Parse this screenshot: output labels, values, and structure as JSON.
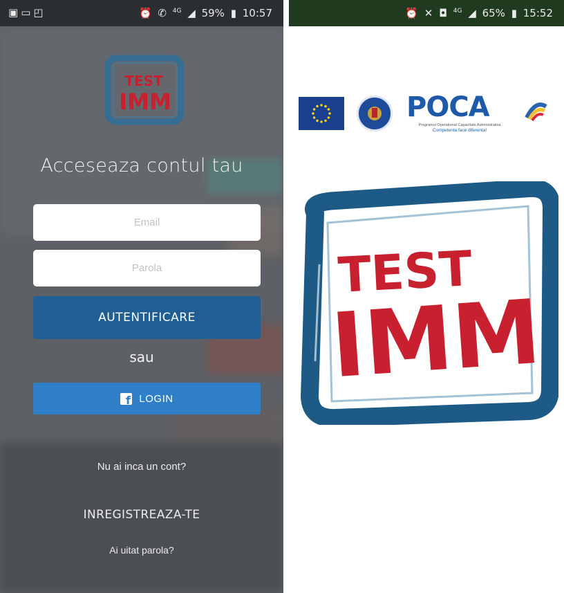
{
  "left_screen": {
    "status_bar": {
      "left_icons": [
        "image-icon",
        "laptop-icon",
        "file-icon"
      ],
      "signal_label": "4G",
      "battery_percent": "59%",
      "time": "10:57"
    },
    "logo": {
      "line1": "TEST",
      "line2": "IMM"
    },
    "title": "Acceseaza contul tau",
    "email_placeholder": "Email",
    "password_placeholder": "Parola",
    "login_button": "AUTENTIFICARE",
    "separator": "sau",
    "facebook_button": "LOGIN",
    "no_account_text": "Nu ai inca un cont?",
    "register_link": "INREGISTREAZA-TE",
    "forgot_link": "Ai uitat parola?"
  },
  "right_screen": {
    "status_bar": {
      "signal_label": "4G",
      "battery_percent": "65%",
      "time": "15:52"
    },
    "partner_logos": {
      "poca": "POCA",
      "poca_subtitle": "Programul Operational Capacitate Administrativa",
      "poca_slogan": "Competenta face diferenta!"
    },
    "splash_logo": {
      "line1": "TEST",
      "line2": "IMM"
    }
  },
  "colors": {
    "primary_button": "#1f5f93",
    "facebook_button": "#2f80c8",
    "logo_red": "#c8202f",
    "logo_blue": "#1d5a86"
  }
}
